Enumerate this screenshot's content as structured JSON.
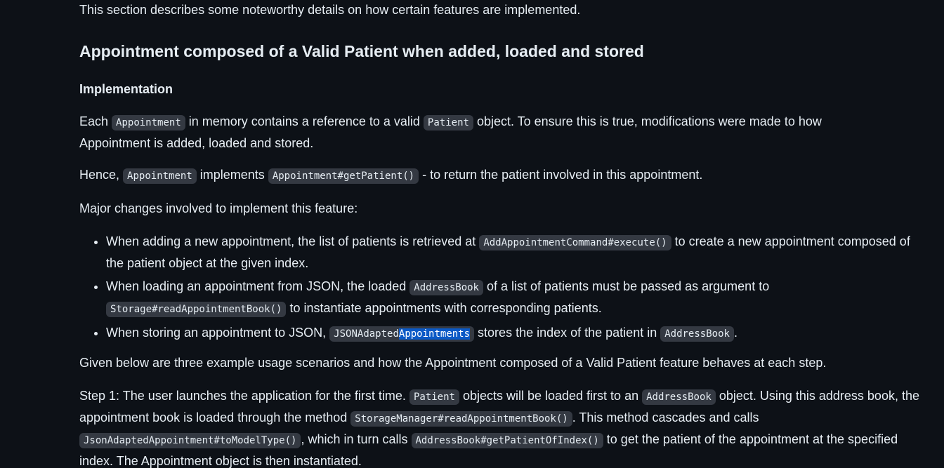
{
  "intro": "This section describes some noteworthy details on how certain features are implemented.",
  "heading": "Appointment composed of a Valid Patient when added, loaded and stored",
  "subheading": "Implementation",
  "para_each": {
    "t1": "Each ",
    "c1": "Appointment",
    "t2": " in memory contains a reference to a valid ",
    "c2": "Patient",
    "t3": " object. To ensure this is true, modifications were made to how Appointment is added, loaded and stored."
  },
  "para_hence": {
    "t1": "Hence, ",
    "c1": "Appointment",
    "t2": " implements ",
    "c2": "Appointment#getPatient()",
    "t3": " - to return the patient involved in this appointment."
  },
  "para_major": "Major changes involved to implement this feature:",
  "bullets": {
    "b1": {
      "t1": "When adding a new appointment, the list of patients is retrieved at ",
      "c1": "AddAppointmentCommand#execute()",
      "t2": " to create a new appointment composed of the patient object at the given index."
    },
    "b2": {
      "t1": "When loading an appointment from JSON, the loaded ",
      "c1": "AddressBook",
      "t2": " of a list of patients must be passed as argument to ",
      "c2": "Storage#readAppointmentBook()",
      "t3": " to instantiate appointments with corresponding patients."
    },
    "b3": {
      "t1": "When storing an appointment to JSON, ",
      "c1a": "JSONAdapted",
      "c1b": "Appointments",
      "t2": " stores the index of the patient in ",
      "c2": "AddressBook",
      "t3": "."
    }
  },
  "para_given": "Given below are three example usage scenarios and how the Appointment composed of a Valid Patient feature behaves at each step.",
  "para_step1": {
    "t1": "Step 1: The user launches the application for the first time. ",
    "c1": "Patient",
    "t2": " objects will be loaded first to an ",
    "c2": "AddressBook",
    "t3": " object. Using this address book, the appointment book is loaded through the method ",
    "c3": "StorageManager#readAppointmentBook()",
    "t4": ". This method cascades and calls ",
    "c4": "JsonAdaptedAppointment#toModelType()",
    "t5": ", which in turn calls ",
    "c5": "AddressBook#getPatientOfIndex()",
    "t6": " to get the patient of the appointment at the specified index. The Appointment object is then instantiated."
  },
  "colors": {
    "background": "#0d1117",
    "text": "#e6edf3",
    "code_bg": "#343942",
    "selection": "#0b59c6"
  }
}
